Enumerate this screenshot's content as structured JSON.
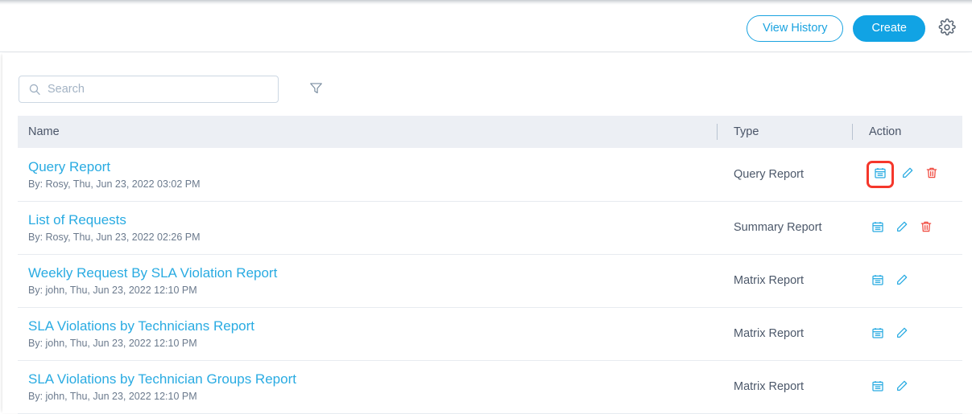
{
  "header": {
    "view_history_label": "View History",
    "create_label": "Create",
    "settings_icon": "gear-icon"
  },
  "toolbar": {
    "search_placeholder": "Search",
    "search_value": "",
    "search_icon": "search-icon",
    "filter_icon": "funnel-filter-icon"
  },
  "table": {
    "columns": [
      "Name",
      "Type",
      "Action"
    ],
    "rows": [
      {
        "name": "Query Report",
        "meta": "By: Rosy, Thu, Jun 23, 2022 03:02 PM",
        "type": "Query Report",
        "actions": [
          "schedule-calendar-icon",
          "edit-pencil-icon",
          "delete-trash-icon"
        ],
        "highlighted_action": "schedule-calendar-icon"
      },
      {
        "name": "List of Requests",
        "meta": "By: Rosy, Thu, Jun 23, 2022 02:26 PM",
        "type": "Summary Report",
        "actions": [
          "schedule-calendar-icon",
          "edit-pencil-icon",
          "delete-trash-icon"
        ],
        "highlighted_action": null
      },
      {
        "name": "Weekly Request By SLA Violation Report",
        "meta": "By: john, Thu, Jun 23, 2022 12:10 PM",
        "type": "Matrix Report",
        "actions": [
          "schedule-calendar-icon",
          "edit-pencil-icon"
        ],
        "highlighted_action": null
      },
      {
        "name": "SLA Violations by Technicians Report",
        "meta": "By: john, Thu, Jun 23, 2022 12:10 PM",
        "type": "Matrix Report",
        "actions": [
          "schedule-calendar-icon",
          "edit-pencil-icon"
        ],
        "highlighted_action": null
      },
      {
        "name": "SLA Violations by Technician Groups Report",
        "meta": "By: john, Thu, Jun 23, 2022 12:10 PM",
        "type": "Matrix Report",
        "actions": [
          "schedule-calendar-icon",
          "edit-pencil-icon"
        ],
        "highlighted_action": null
      }
    ]
  },
  "colors": {
    "accent": "#29abe2",
    "create_button": "#11a3e4",
    "danger": "#f04a3f",
    "highlight_box": "#f5372b",
    "header_row": "#eceff4",
    "text_primary": "#4a5568"
  }
}
